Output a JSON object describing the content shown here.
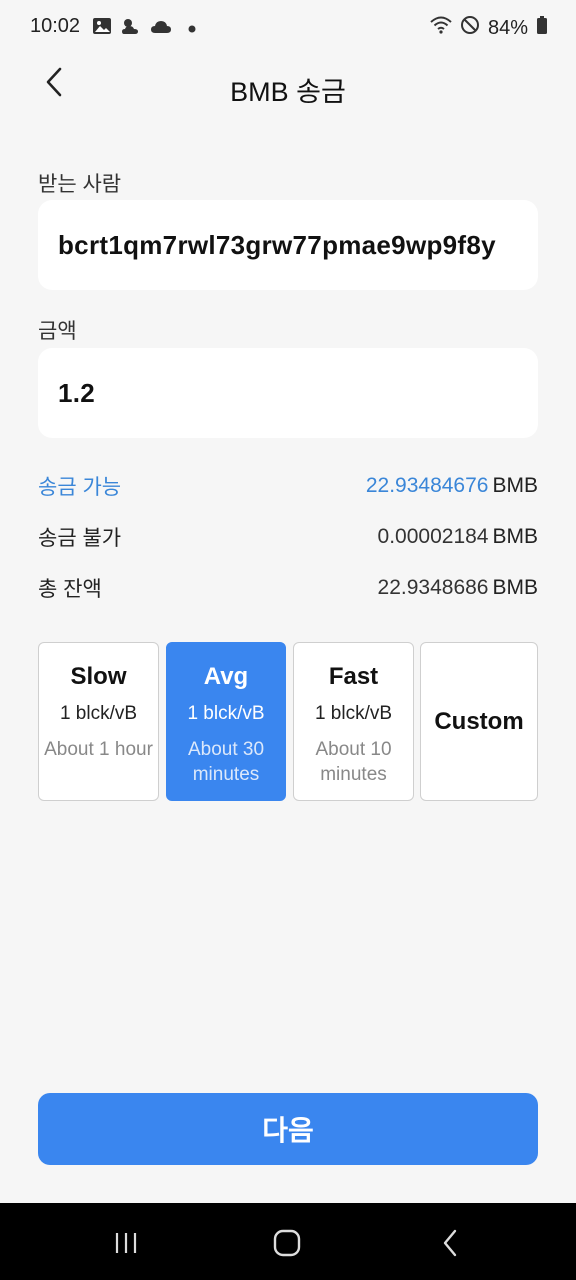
{
  "status_bar": {
    "time": "10:02",
    "battery": "84%",
    "icons": [
      "image-icon",
      "weather-icon",
      "cloud-icon",
      "dot-icon",
      "wifi-icon",
      "do-not-disturb-icon",
      "battery-icon"
    ]
  },
  "header": {
    "title": "BMB 송금",
    "back_icon": "chevron-left-icon"
  },
  "recipient": {
    "label": "받는 사람",
    "value": "bcrt1qm7rwl73grw77pmae9wp9f8y"
  },
  "amount": {
    "label": "금액",
    "value": "1.2"
  },
  "balances": {
    "sendable": {
      "label": "송금 가능",
      "amount": "22.93484676",
      "unit": "BMB"
    },
    "unsendable": {
      "label": "송금 불가",
      "amount": "0.00002184",
      "unit": "BMB"
    },
    "total": {
      "label": "총 잔액",
      "amount": "22.9348686",
      "unit": "BMB"
    }
  },
  "fees": {
    "selected": "Avg",
    "options": [
      {
        "name": "Slow",
        "rate": "1 blck/vB",
        "time": "About 1 hour"
      },
      {
        "name": "Avg",
        "rate": "1 blck/vB",
        "time": "About 30 minutes"
      },
      {
        "name": "Fast",
        "rate": "1 blck/vB",
        "time": "About 10 minutes"
      },
      {
        "name": "Custom"
      }
    ]
  },
  "next_button": {
    "label": "다음"
  },
  "colors": {
    "accent": "#3a86ef",
    "highlight_text": "#3a86d8",
    "background": "#f6f6f6"
  }
}
